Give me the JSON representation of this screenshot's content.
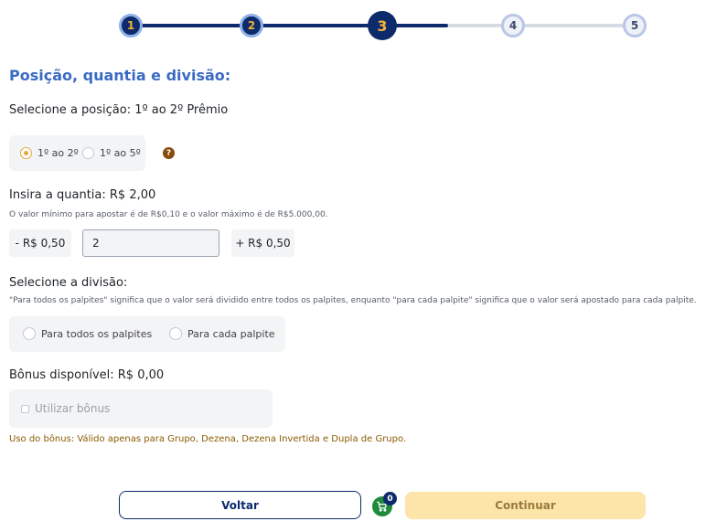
{
  "stepper": {
    "steps": [
      "1",
      "2",
      "3",
      "4",
      "5"
    ],
    "current": 3
  },
  "section": {
    "title": "Posição, quantia e divisão:"
  },
  "position": {
    "label": "Selecione a posição: 1º ao 2º Prêmio",
    "options": [
      "1º ao 2º",
      "1º ao 5º"
    ],
    "selected": "1º ao 2º",
    "help_icon": "question-circle-icon",
    "help_text": "?"
  },
  "amount": {
    "label": "Insira a quantia: R$ 2,00",
    "hint": "O valor mínimo para apostar é de R$0,10 e o valor máximo é de R$5.000,00.",
    "decrement_label": "- R$ 0,50",
    "value": "2",
    "increment_label": "+ R$ 0,50"
  },
  "division": {
    "label": "Selecione a divisão:",
    "hint": "\"Para todos os palpites\" significa que o valor será dividido entre todos os palpites, enquanto \"para cada palpite\" significa que o valor será apostado para cada palpite.",
    "options": [
      "Para todos os palpites",
      "Para cada palpite"
    ]
  },
  "bonus": {
    "label": "Bônus disponível: R$ 0,00",
    "checkbox_label": "Utilizar bônus",
    "note": "Uso do bônus: Válido apenas para Grupo, Dezena, Dezena Invertida e Dupla de Grupo."
  },
  "footer": {
    "back_label": "Voltar",
    "continue_label": "Continuar",
    "cart_icon": "cart-icon",
    "cart_count": "0"
  },
  "colors": {
    "primary": "#0d2a6b",
    "accent": "#e7a83a",
    "title": "#3a6bc4",
    "continue_bg": "#fde4a8",
    "cart": "#1e8a3a"
  }
}
